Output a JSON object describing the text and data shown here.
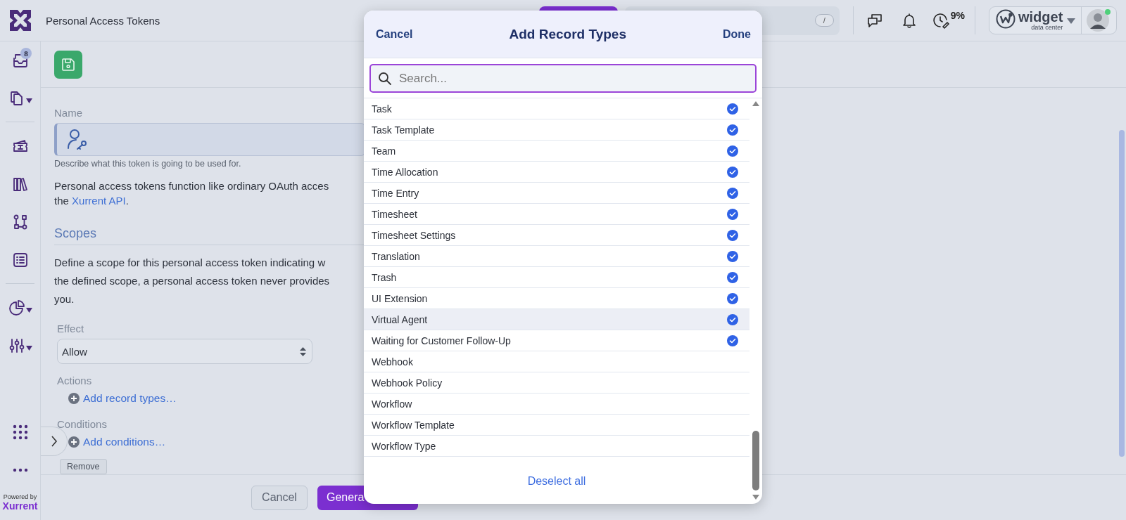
{
  "topbar": {
    "title": "Personal Access Tokens",
    "search_shortcut": "/",
    "timer_percent": "9%",
    "account_name": "widget",
    "account_subtitle": "data center",
    "online": true
  },
  "sidebar": {
    "items": [
      {
        "kind": "inbox",
        "badge": "8",
        "dropdown": false
      },
      {
        "kind": "copy",
        "dropdown": true
      },
      {
        "kind": "divider"
      },
      {
        "kind": "ticket",
        "dropdown": false
      },
      {
        "kind": "books",
        "dropdown": false
      },
      {
        "kind": "workflow",
        "dropdown": false
      },
      {
        "kind": "form",
        "dropdown": false
      },
      {
        "kind": "divider"
      },
      {
        "kind": "pie",
        "dropdown": true
      },
      {
        "kind": "sliders",
        "dropdown": true
      }
    ],
    "bottom_items": [
      {
        "kind": "grid"
      },
      {
        "kind": "more"
      }
    ],
    "powered_by": "Powered by",
    "brand": "Xurrent"
  },
  "form": {
    "name_label": "Name",
    "name_hint": "Describe what this token is going to be used for.",
    "intro_line_1": "Personal access tokens function like ordinary OAuth acces",
    "intro_line_2_start": "the ",
    "intro_link": "Xurrent API",
    "intro_line_2_end": ".",
    "scopes_heading": "Scopes",
    "scopes_lines": [
      "Define a scope for this personal access token indicating w",
      "the defined scope, a personal access token never provides",
      "you."
    ],
    "effect_label": "Effect",
    "effect_value": "Allow",
    "actions_label": "Actions",
    "add_record_types": "Add record types…",
    "conditions_label": "Conditions",
    "add_conditions": "Add conditions…",
    "remove": "Remove"
  },
  "footer": {
    "cancel": "Cancel",
    "generate": "Genera"
  },
  "modal": {
    "cancel": "Cancel",
    "title": "Add Record Types",
    "done": "Done",
    "search_placeholder": "Search...",
    "items": [
      {
        "label": "Task",
        "checked": true,
        "hovered": false
      },
      {
        "label": "Task Template",
        "checked": true,
        "hovered": false
      },
      {
        "label": "Team",
        "checked": true,
        "hovered": false
      },
      {
        "label": "Time Allocation",
        "checked": true,
        "hovered": false
      },
      {
        "label": "Time Entry",
        "checked": true,
        "hovered": false
      },
      {
        "label": "Timesheet",
        "checked": true,
        "hovered": false
      },
      {
        "label": "Timesheet Settings",
        "checked": true,
        "hovered": false
      },
      {
        "label": "Translation",
        "checked": true,
        "hovered": false
      },
      {
        "label": "Trash",
        "checked": true,
        "hovered": false
      },
      {
        "label": "UI Extension",
        "checked": true,
        "hovered": false
      },
      {
        "label": "Virtual Agent",
        "checked": true,
        "hovered": true
      },
      {
        "label": "Waiting for Customer Follow-Up",
        "checked": true,
        "hovered": false
      },
      {
        "label": "Webhook",
        "checked": false,
        "hovered": false
      },
      {
        "label": "Webhook Policy",
        "checked": false,
        "hovered": false
      },
      {
        "label": "Workflow",
        "checked": false,
        "hovered": false
      },
      {
        "label": "Workflow Template",
        "checked": false,
        "hovered": false
      },
      {
        "label": "Workflow Type",
        "checked": false,
        "hovered": false
      }
    ],
    "deselect_all": "Deselect all"
  }
}
